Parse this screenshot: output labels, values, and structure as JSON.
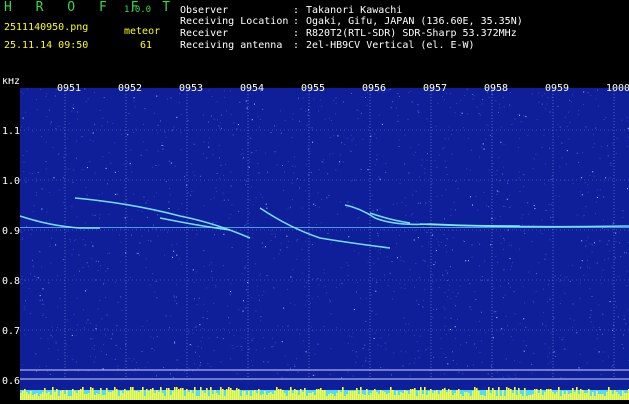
{
  "header": {
    "app_name": "H R O F F T",
    "version": "1.0.0",
    "filename": "2511140950.png",
    "datetime": "25.11.14 09:50",
    "meteor_label": "meteor",
    "meteor_count": "61",
    "info": [
      {
        "label": "Observer",
        "value": "Takanori Kawachi"
      },
      {
        "label": "Receiving Location",
        "value": "Ogaki, Gifu, JAPAN (136.60E, 35.35N)"
      },
      {
        "label": "Receiver",
        "value": "R820T2(RTL-SDR) SDR-Sharp 53.372MHz"
      },
      {
        "label": "Receiving antenna",
        "value": "2el-HB9CV Vertical (el. E-W)"
      }
    ]
  },
  "plot": {
    "y_unit": "kHz",
    "y_ticks": [
      "1.1",
      "1.0",
      "0.9",
      "0.8",
      "0.7",
      "0.6"
    ],
    "x_ticks": [
      "0951",
      "0952",
      "0953",
      "0954",
      "0955",
      "0956",
      "0957",
      "0958",
      "0959",
      "1000"
    ],
    "colors": {
      "background": "#0f1f9a",
      "grid": "#6f84e0",
      "trace": "#7ff0ff",
      "bars": "#ffff30",
      "floor": "#4fdcff"
    }
  }
}
